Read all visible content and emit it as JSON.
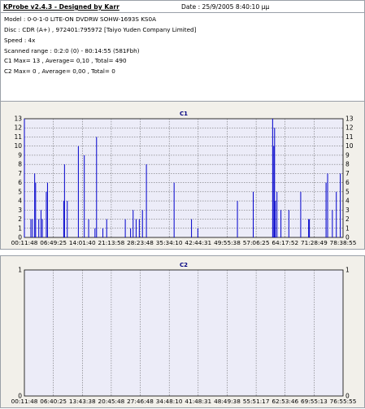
{
  "header": {
    "app_title": "KProbe v2.4.3 - Designed by Karr",
    "date": "Date : 25/9/2005 8:40:10 μμ",
    "model": "Model : 0-0-1-0 LITE-ON DVDRW SOHW-1693S KS0A",
    "disc": "Disc : CDR (A+) , 972401:795972 [Taiyo Yuden Company Limited]",
    "speed": "Speed : 4x",
    "scanned_range": "Scanned range : 0:2:0 (0) - 80:14:55 (581Fbh)",
    "c1_stats": "C1 Max= 13 , Average= 0,10 , Total= 490",
    "c2_stats": "C2 Max= 0 , Average= 0,00 , Total= 0"
  },
  "colors": {
    "bar": "#0000cc",
    "plot_bg": "#ececf8",
    "panel_bg": "#f2f0ea",
    "title": "#000080"
  },
  "chart_data": [
    {
      "type": "bar",
      "title": "C1",
      "ylim": [
        0,
        13
      ],
      "yticks": [
        "0",
        "1",
        "2",
        "3",
        "4",
        "5",
        "6",
        "7",
        "8",
        "9",
        "10",
        "11",
        "12",
        "13"
      ],
      "xticks": [
        "00:11:48",
        "06:49:25",
        "14:01:40",
        "21:13:58",
        "28:23:48",
        "35:34:10",
        "42:44:31",
        "49:55:38",
        "57:06:25",
        "64:17:52",
        "71:28:49",
        "78:38:55"
      ],
      "xlim_sec": [
        708,
        4735
      ],
      "grid": true,
      "bars": [
        {
          "t": 708,
          "v": 13
        },
        {
          "t": 790,
          "v": 2
        },
        {
          "t": 810,
          "v": 2
        },
        {
          "t": 838,
          "v": 7
        },
        {
          "t": 850,
          "v": 6
        },
        {
          "t": 890,
          "v": 2
        },
        {
          "t": 918,
          "v": 3
        },
        {
          "t": 935,
          "v": 2
        },
        {
          "t": 985,
          "v": 5
        },
        {
          "t": 1000,
          "v": 6
        },
        {
          "t": 1205,
          "v": 4
        },
        {
          "t": 1215,
          "v": 8
        },
        {
          "t": 1250,
          "v": 4
        },
        {
          "t": 1390,
          "v": 10
        },
        {
          "t": 1465,
          "v": 9
        },
        {
          "t": 1520,
          "v": 2
        },
        {
          "t": 1600,
          "v": 1
        },
        {
          "t": 1620,
          "v": 11
        },
        {
          "t": 1700,
          "v": 1
        },
        {
          "t": 1748,
          "v": 2
        },
        {
          "t": 1983,
          "v": 2
        },
        {
          "t": 2050,
          "v": 1
        },
        {
          "t": 2082,
          "v": 3
        },
        {
          "t": 2120,
          "v": 2
        },
        {
          "t": 2160,
          "v": 2
        },
        {
          "t": 2200,
          "v": 3
        },
        {
          "t": 2250,
          "v": 8
        },
        {
          "t": 2600,
          "v": 6
        },
        {
          "t": 2820,
          "v": 2
        },
        {
          "t": 2900,
          "v": 1
        },
        {
          "t": 3400,
          "v": 4
        },
        {
          "t": 3600,
          "v": 5
        },
        {
          "t": 3845,
          "v": 13
        },
        {
          "t": 3860,
          "v": 10
        },
        {
          "t": 3870,
          "v": 12
        },
        {
          "t": 3880,
          "v": 4
        },
        {
          "t": 3900,
          "v": 5
        },
        {
          "t": 3950,
          "v": 3
        },
        {
          "t": 4050,
          "v": 3
        },
        {
          "t": 4200,
          "v": 5
        },
        {
          "t": 4300,
          "v": 2
        },
        {
          "t": 4310,
          "v": 2
        },
        {
          "t": 4520,
          "v": 6
        },
        {
          "t": 4540,
          "v": 7
        },
        {
          "t": 4600,
          "v": 3
        },
        {
          "t": 4650,
          "v": 5
        },
        {
          "t": 4700,
          "v": 7
        }
      ]
    },
    {
      "type": "bar",
      "title": "C2",
      "ylim": [
        0,
        1
      ],
      "yticks": [
        "0",
        "1"
      ],
      "xticks": [
        "00:11:48",
        "06:40:25",
        "13:43:38",
        "20:45:48",
        "27:46:48",
        "34:48:10",
        "41:48:31",
        "48:49:38",
        "55:51:17",
        "62:53:46",
        "69:55:13",
        "76:55:55"
      ],
      "xlim_sec": [
        708,
        4735
      ],
      "grid": true,
      "bars": []
    }
  ]
}
